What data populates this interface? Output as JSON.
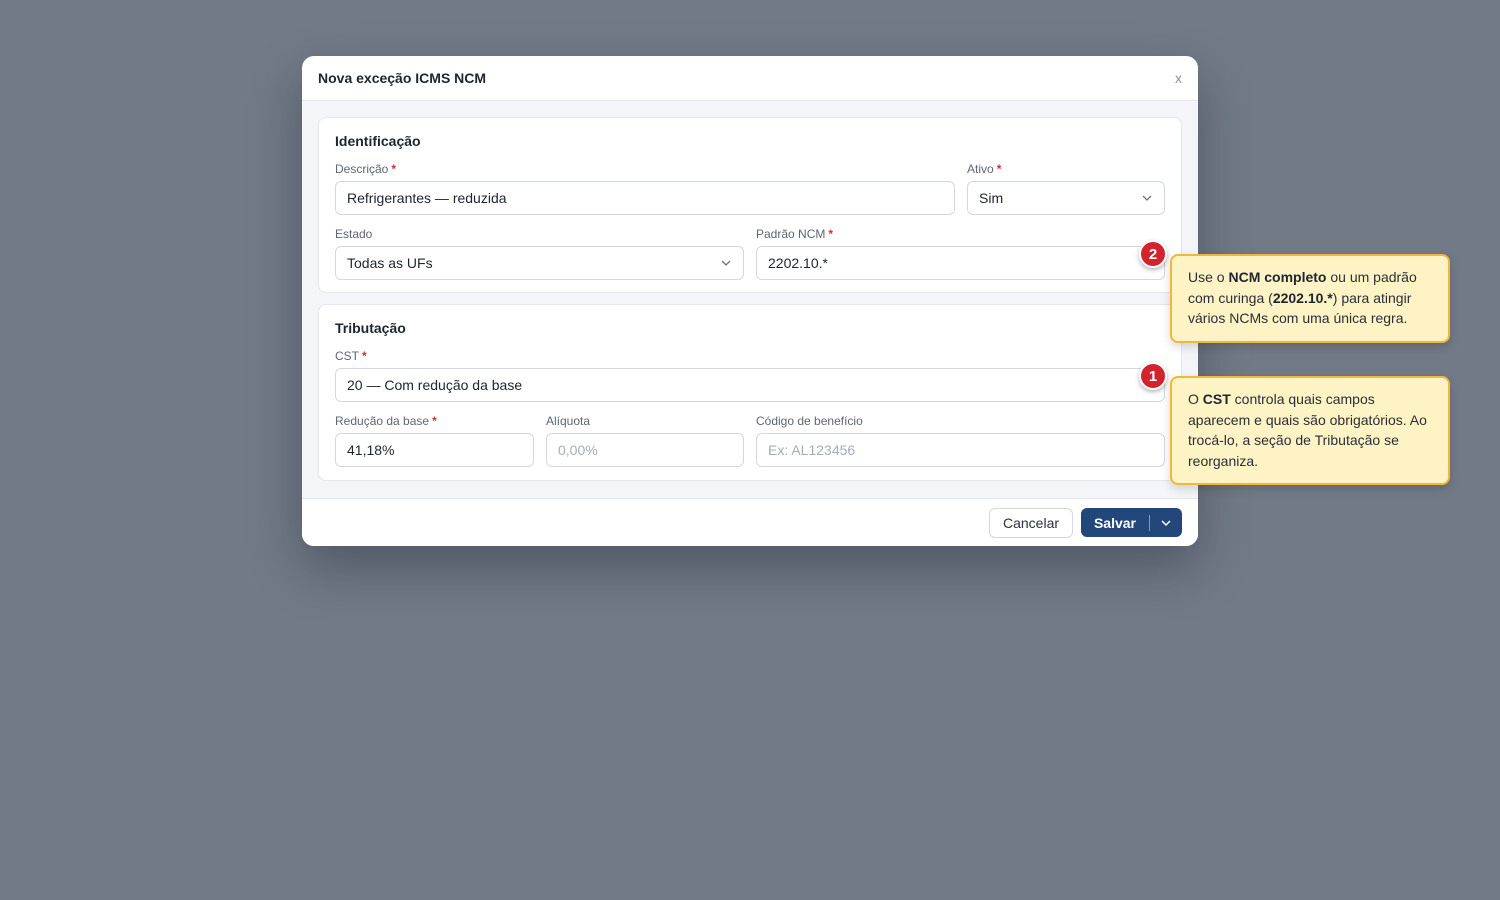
{
  "modal": {
    "title": "Nova exceção ICMS NCM",
    "close_label": "x"
  },
  "identificacao": {
    "title": "Identificação",
    "descricao": {
      "label": "Descrição",
      "value": "Refrigerantes — reduzida"
    },
    "ativo": {
      "label": "Ativo",
      "value": "Sim"
    },
    "estado": {
      "label": "Estado",
      "value": "Todas as UFs"
    },
    "padrao_ncm": {
      "label": "Padrão NCM",
      "value": "2202.10.*"
    }
  },
  "tributacao": {
    "title": "Tributação",
    "cst": {
      "label": "CST",
      "value": "20 — Com redução da base"
    },
    "reducao_base": {
      "label": "Redução da base",
      "value": "41,18%"
    },
    "aliquota": {
      "label": "Alíquota",
      "placeholder": "0,00%"
    },
    "codigo_beneficio": {
      "label": "Código de benefício",
      "placeholder": "Ex: AL123456"
    }
  },
  "required_marker": "*",
  "footer": {
    "cancel_label": "Cancelar",
    "save_label": "Salvar"
  },
  "tips": {
    "ncm": {
      "badge": "2",
      "t1": "Use o ",
      "b1": "NCM completo",
      "t2": " ou um padrão com curinga (",
      "b2": "2202.10.*",
      "t3": ") para atingir vários NCMs com uma única regra."
    },
    "cst": {
      "badge": "1",
      "t1": "O ",
      "b1": "CST",
      "t2": " controla quais campos aparecem e quais são obrigatórios. Ao trocá-lo, a seção de Tributação se reorganiza."
    }
  },
  "colors": {
    "backdrop": "#717a86",
    "primary": "#24477b",
    "badge": "#d1242f",
    "tip_bg": "#fef3c4",
    "tip_border": "#f2b63c",
    "required": "#d0312d"
  },
  "icons": {
    "close": "close-icon",
    "dropdown": "chevron-down-icon"
  }
}
